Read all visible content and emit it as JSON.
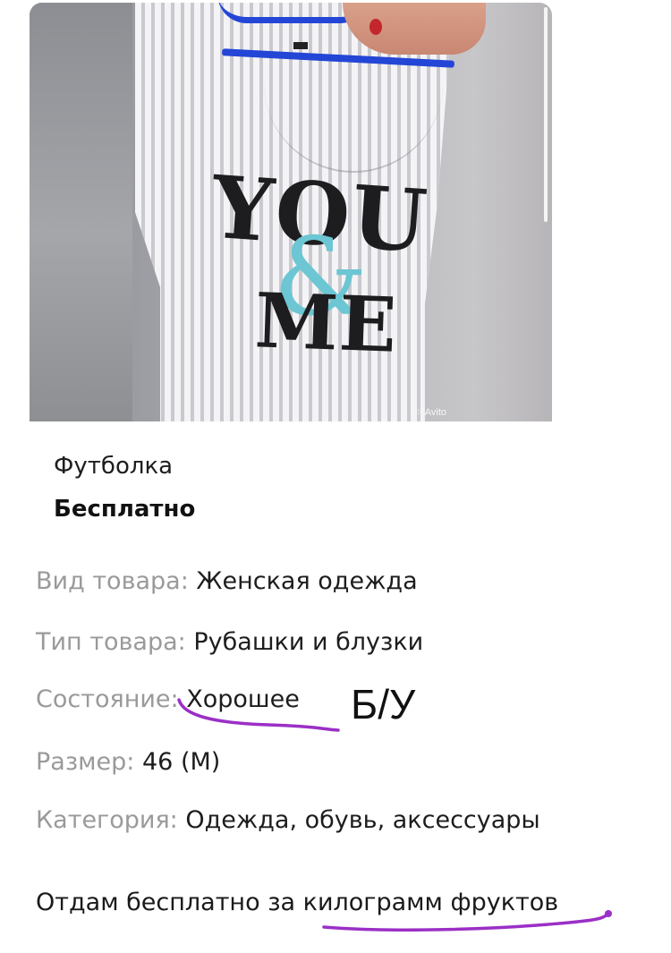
{
  "photo": {
    "print_line1": "YOU",
    "print_amp": "&",
    "print_line2": "ME",
    "watermark": "Avito"
  },
  "listing": {
    "title": "Футболка",
    "price": "Бесплатно"
  },
  "params": [
    {
      "key": "Вид товара:",
      "value": "Женская одежда"
    },
    {
      "key": "Тип товара:",
      "value": "Рубашки и блузки"
    },
    {
      "key": "Состояние:",
      "value": "Хорошее"
    },
    {
      "key": "Размер:",
      "value": "46 (M)"
    },
    {
      "key": "Категория:",
      "value": "Одежда, обувь, аксессуары"
    }
  ],
  "annotation": {
    "text": "Б/У",
    "underline_color": "#9b2fc6"
  },
  "description": "Отдам бесплатно за килограмм фруктов"
}
